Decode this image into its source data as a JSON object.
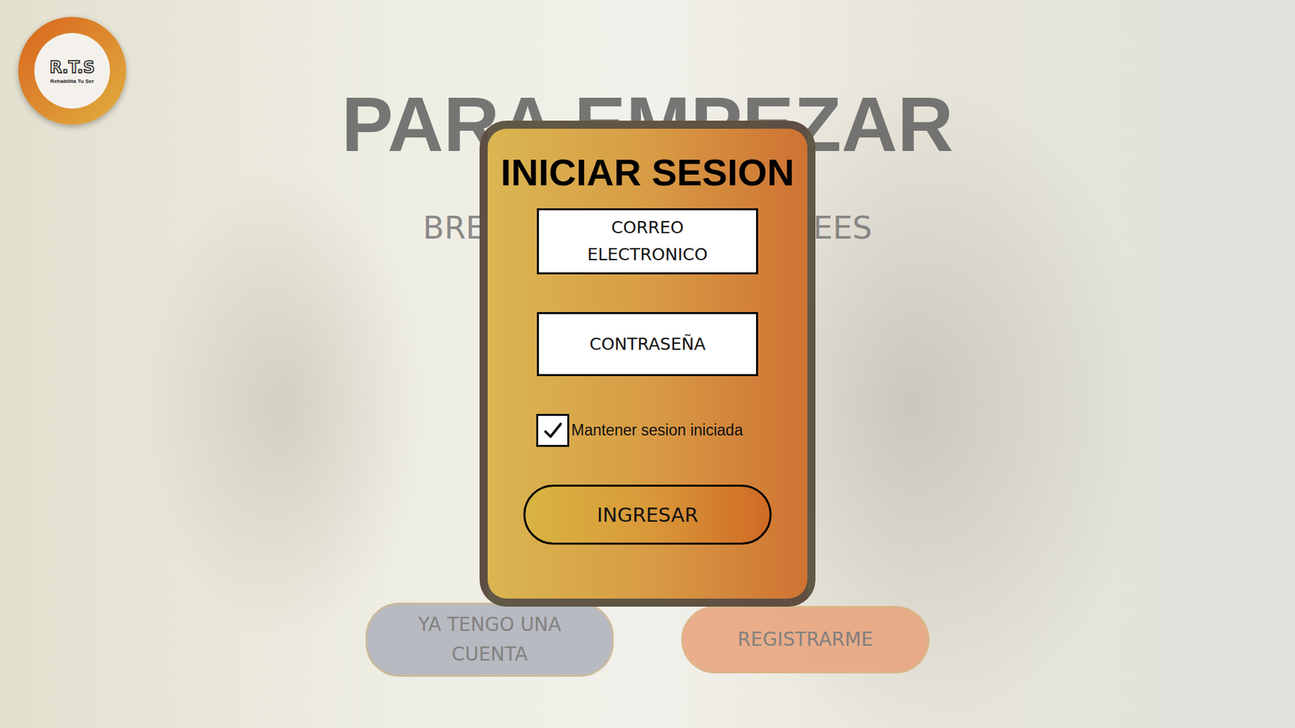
{
  "logo": {
    "initials": "R.T.S",
    "tagline": "Rehabilita Tu Ser"
  },
  "background": {
    "title": "PARA EMPEZAR",
    "subtitle": {
      "left": "BREV",
      "right": "NEES"
    },
    "buttons": [
      {
        "label": "YA TENGO UNA CUENTA",
        "color": "#aeb1bb"
      },
      {
        "label": "REGISTRARME",
        "color": "#e9a37c"
      }
    ]
  },
  "dialog": {
    "title": "INICIAR SESION",
    "fields": [
      {
        "placeholder": "CORREO ELECTRONICO"
      },
      {
        "placeholder": "CONTRASEÑA"
      }
    ],
    "remember": {
      "label": "Mantener sesion iniciada",
      "checked": true
    },
    "submit": "INGRESAR"
  }
}
